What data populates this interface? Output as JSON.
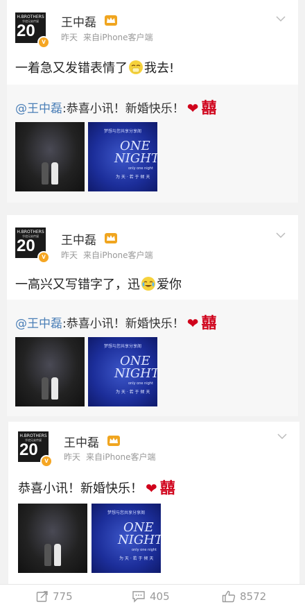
{
  "posts": [
    {
      "author": "王中磊",
      "avatar_brand": "H.BROTHERS",
      "avatar_sub": "华谊兄弟传媒",
      "avatar_num": "20",
      "verified_mark": "v",
      "time": "昨天",
      "source": "来自iPhone客户端",
      "text_before": "一着急又发错表情了",
      "text_after": "我去!",
      "repost": {
        "mention": "@王中磊",
        "text": ":恭喜小讯！新婚快乐！",
        "heart": "❤",
        "xi": "囍"
      },
      "photo2": {
        "head": "梦想与您共享分享阁",
        "one": "ONE",
        "night": "NIGHT",
        "small": "only one night",
        "foot": "为 天 · 若 于 倾 天"
      }
    },
    {
      "author": "王中磊",
      "avatar_brand": "H.BROTHERS",
      "avatar_sub": "华谊兄弟传媒",
      "avatar_num": "20",
      "verified_mark": "v",
      "time": "昨天",
      "source": "来自iPhone客户端",
      "text_before": "一高兴又写错字了，迅",
      "text_after": "爱你",
      "repost": {
        "mention": "@王中磊",
        "text": ":恭喜小讯！新婚快乐！",
        "heart": "❤",
        "xi": "囍"
      },
      "photo2": {
        "head": "梦想与您共享分享阁",
        "one": "ONE",
        "night": "NIGHT",
        "small": "only one night",
        "foot": "为 天 · 若 于 倾 天"
      }
    },
    {
      "author": "王中磊",
      "avatar_brand": "H.BROTHERS",
      "avatar_sub": "华谊兄弟传媒",
      "avatar_num": "20",
      "verified_mark": "v",
      "time": "昨天",
      "source": "来自iPhone客户端",
      "text": "恭喜小讯！新婚快乐！",
      "heart": "❤",
      "xi": "囍",
      "photo2": {
        "head": "梦想与您共享分享阁",
        "one": "ONE",
        "night": "NIGHT",
        "small": "only one night",
        "foot": "为 天 · 若 于 倾 天"
      }
    }
  ],
  "toolbar": {
    "repost_count": "775",
    "comment_count": "405",
    "like_count": "8572"
  },
  "icons": {
    "repost": "repost-icon",
    "comment": "comment-icon",
    "like": "like-icon",
    "more": "chevron-down-icon",
    "crown": "crown-icon"
  },
  "colors": {
    "link": "#4b7fb7",
    "heart": "#d0021b",
    "badge": "#f5a623",
    "muted": "#999999"
  }
}
